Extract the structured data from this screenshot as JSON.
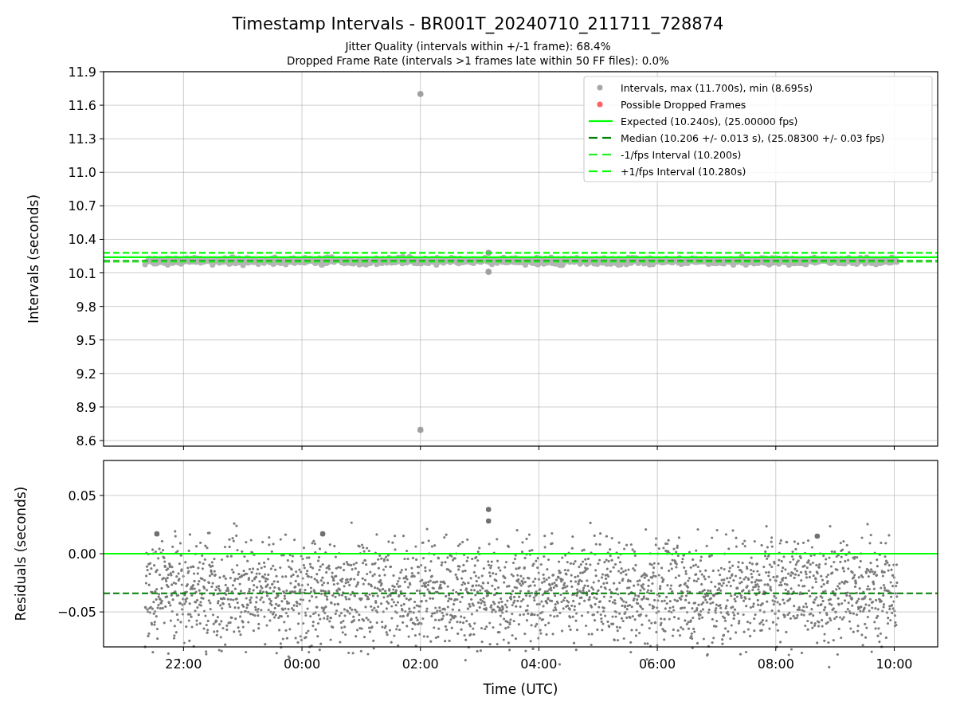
{
  "figure": {
    "title": "Timestamp Intervals - BR001T_20240710_211711_728874",
    "subtitles": [
      "Jitter Quality (intervals within +/-1 frame): 68.4%",
      "Dropped Frame Rate (intervals >1 frames late within 50 FF files): 0.0%"
    ]
  },
  "plots": [
    {
      "chart_data": {
        "type": "scatter",
        "ylabel": "Intervals (seconds)",
        "grid": true,
        "xlim": [
          "2024-07-10T20:39",
          "2024-07-11T10:44"
        ],
        "ylim": [
          8.55,
          11.9
        ],
        "yticks": [
          {
            "value": 8.6,
            "label": "8.6"
          },
          {
            "value": 8.9,
            "label": "8.9"
          },
          {
            "value": 9.2,
            "label": "9.2"
          },
          {
            "value": 9.5,
            "label": "9.5"
          },
          {
            "value": 9.8,
            "label": "9.8"
          },
          {
            "value": 10.1,
            "label": "10.1"
          },
          {
            "value": 10.4,
            "label": "10.4"
          },
          {
            "value": 10.7,
            "label": "10.7"
          },
          {
            "value": 11.0,
            "label": "11.0"
          },
          {
            "value": 11.3,
            "label": "11.3"
          },
          {
            "value": 11.6,
            "label": "11.6"
          },
          {
            "value": 11.9,
            "label": "11.9"
          }
        ],
        "series": [
          {
            "color": "#a0a0a0",
            "x": [
              "2024-07-11T02:00",
              "2024-07-11T02:00",
              "2024-07-11T03:09",
              "2024-07-11T03:09"
            ],
            "values": [
              11.7,
              8.695,
              10.28,
              10.11
            ]
          }
        ],
        "ref_lines": [
          {
            "axis": "y",
            "value": 10.24,
            "color": "#00ff00"
          },
          {
            "axis": "y",
            "value": 10.206,
            "color": "#008000"
          },
          {
            "axis": "y",
            "value": 10.2,
            "color": "#22ee22"
          },
          {
            "axis": "y",
            "value": 10.28,
            "color": "#00ff00"
          }
        ]
      },
      "legend": [
        {
          "label": "Intervals, max (11.700s), min (8.695s)",
          "kind": "dot",
          "color": "#a8a8a8"
        },
        {
          "label": "Possible Dropped Frames",
          "kind": "dot",
          "color": "#ff6060"
        },
        {
          "label": "Expected (10.240s), (25.00000 fps)",
          "kind": "line",
          "color": "#00ff00"
        },
        {
          "label": "Median (10.206 +/- 0.013 s), (25.08300 +/- 0.03 fps)",
          "kind": "dashed",
          "color": "#008000"
        },
        {
          "label": "-1/fps Interval (10.200s)",
          "kind": "dashed",
          "color": "#22ee22"
        },
        {
          "label": "+1/fps Interval (10.280s)",
          "kind": "dashed",
          "color": "#00ff00"
        }
      ]
    },
    {
      "chart_data": {
        "type": "scatter",
        "xlabel": "Time (UTC)",
        "ylabel": "Residuals (seconds)",
        "grid": true,
        "xlim": [
          "2024-07-10T20:39",
          "2024-07-11T10:44"
        ],
        "ylim": [
          -0.08,
          0.08
        ],
        "xticks": [
          {
            "value": "2024-07-10T22:00",
            "label": "22:00"
          },
          {
            "value": "2024-07-11T00:00",
            "label": "00:00"
          },
          {
            "value": "2024-07-11T02:00",
            "label": "02:00"
          },
          {
            "value": "2024-07-11T04:00",
            "label": "04:00"
          },
          {
            "value": "2024-07-11T06:00",
            "label": "06:00"
          },
          {
            "value": "2024-07-11T08:00",
            "label": "08:00"
          },
          {
            "value": "2024-07-11T10:00",
            "label": "10:00"
          }
        ],
        "yticks": [
          {
            "value": -0.05,
            "label": "−0.05"
          },
          {
            "value": 0,
            "label": "0.00"
          },
          {
            "value": 0.05,
            "label": "0.05"
          }
        ],
        "series": [
          {
            "color": "#707070",
            "x": [
              "2024-07-11T03:09",
              "2024-07-11T03:09",
              "2024-07-10T21:33",
              "2024-07-11T00:21",
              "2024-07-11T08:42"
            ],
            "values": [
              0.038,
              0.028,
              0.017,
              0.017,
              0.015
            ]
          }
        ],
        "ref_lines": [
          {
            "axis": "y",
            "value": 0,
            "color": "#00ff00"
          },
          {
            "axis": "y",
            "value": -0.034,
            "color": "#008000"
          }
        ]
      }
    }
  ]
}
